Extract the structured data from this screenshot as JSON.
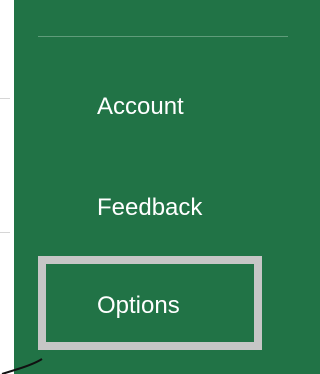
{
  "backstage": {
    "items": [
      {
        "label": "Account"
      },
      {
        "label": "Feedback"
      },
      {
        "label": "Options"
      }
    ],
    "selected": "Options"
  },
  "colors": {
    "nav_background": "#217346",
    "nav_text": "#ffffff",
    "divider": "#5f9c7a",
    "highlight_border": "#c6c6c6"
  }
}
